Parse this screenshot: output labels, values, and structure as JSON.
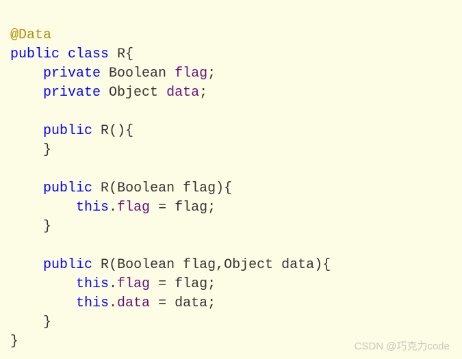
{
  "code": {
    "line1": {
      "annotation": "@Data"
    },
    "line2": {
      "kw1": "public",
      "kw2": "class",
      "name": "R",
      "brace": "{"
    },
    "line3": {
      "indent": "    ",
      "kw": "private",
      "type": "Boolean",
      "field": "flag",
      "semi": ";"
    },
    "line4": {
      "indent": "    ",
      "kw": "private",
      "type": "Object",
      "field": "data",
      "semi": ";"
    },
    "line6": {
      "indent": "    ",
      "kw": "public",
      "name": "R",
      "params": "()",
      "brace": "{"
    },
    "line7": {
      "indent": "    ",
      "brace": "}"
    },
    "line9": {
      "indent": "    ",
      "kw": "public",
      "name": "R",
      "paren_o": "(",
      "ptype": "Boolean",
      "pname": "flag",
      "paren_c": ")",
      "brace": "{"
    },
    "line10": {
      "indent": "        ",
      "this": "this",
      "dot": ".",
      "field": "flag",
      "eq": " = ",
      "var": "flag",
      "semi": ";"
    },
    "line11": {
      "indent": "    ",
      "brace": "}"
    },
    "line13": {
      "indent": "    ",
      "kw": "public",
      "name": "R",
      "paren_o": "(",
      "ptype1": "Boolean",
      "pname1": "flag",
      "comma": ",",
      "ptype2": "Object",
      "pname2": "data",
      "paren_c": ")",
      "brace": "{"
    },
    "line14": {
      "indent": "        ",
      "this": "this",
      "dot": ".",
      "field": "flag",
      "eq": " = ",
      "var": "flag",
      "semi": ";"
    },
    "line15": {
      "indent": "        ",
      "this": "this",
      "dot": ".",
      "field": "data",
      "eq": " = ",
      "var": "data",
      "semi": ";"
    },
    "line16": {
      "indent": "    ",
      "brace": "}"
    },
    "line17": {
      "brace": "}"
    }
  },
  "watermark": "CSDN @巧克力code"
}
